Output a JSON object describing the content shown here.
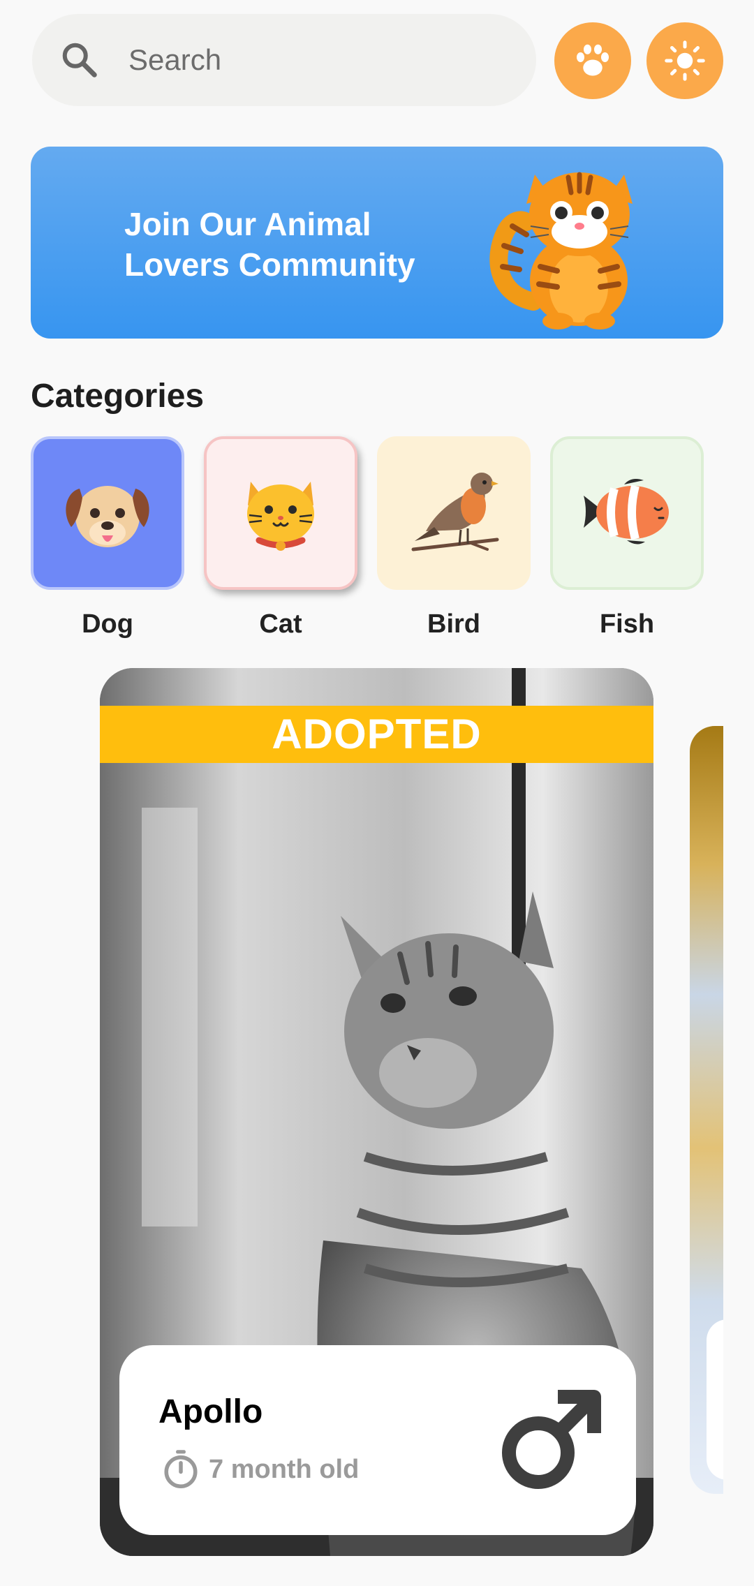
{
  "search": {
    "placeholder": "Search"
  },
  "header_buttons": [
    {
      "icon": "paw-icon",
      "color": "#fba94a"
    },
    {
      "icon": "sun-icon",
      "color": "#fba94a"
    }
  ],
  "banner": {
    "text": "Join Our Animal Lovers Community",
    "color": "#3795f0"
  },
  "categories": {
    "title": "Categories",
    "items": [
      {
        "label": "Dog",
        "icon": "dog-icon",
        "color": "#6e88f7"
      },
      {
        "label": "Cat",
        "icon": "cat-icon",
        "color": "#fdeeee"
      },
      {
        "label": "Bird",
        "icon": "bird-icon",
        "color": "#fdf1d6"
      },
      {
        "label": "Fish",
        "icon": "fish-icon",
        "color": "#edf7e9"
      }
    ]
  },
  "pet_card": {
    "status": "ADOPTED",
    "status_color": "#ffbe0d",
    "name": "Apollo",
    "age": "7 month old",
    "gender_icon": "male-icon"
  }
}
